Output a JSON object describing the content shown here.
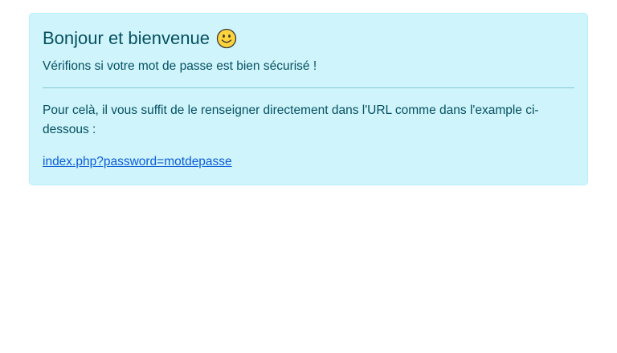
{
  "alert": {
    "heading": "Bonjour et bienvenue",
    "heading_icon": "smiley-face-icon",
    "subtitle": "Vérifions si votre mot de passe est bien sécurisé !",
    "instructions": "Pour celà, il vous suffit de le renseigner directement dans l'URL comme dans l'example ci-dessous :",
    "example_link": "index.php?password=motdepasse"
  },
  "colors": {
    "alert_background": "#cff4fc",
    "alert_border": "#b6effb",
    "alert_text": "#055160",
    "link": "#0b5cd6",
    "smiley_fill": "#ffd43b"
  }
}
